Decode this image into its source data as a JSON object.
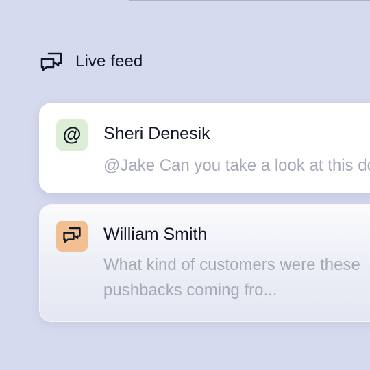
{
  "header": {
    "title": "Live feed",
    "icon": "chat-bubbles-icon"
  },
  "feed": [
    {
      "badge_icon": "at-mention-icon",
      "badge_symbol": "@",
      "badge_color": "#dcefd6",
      "name": "Sheri Denesik",
      "message": "@Jake Can you take a look at this do"
    },
    {
      "badge_icon": "chat-bubbles-icon",
      "badge_color": "#f2bf92",
      "name": "William Smith",
      "message": "What kind of customers were these\npushbacks coming fro..."
    }
  ],
  "colors": {
    "background": "#d6daee",
    "text_primary": "#141826",
    "text_secondary": "#a6a9b8"
  }
}
